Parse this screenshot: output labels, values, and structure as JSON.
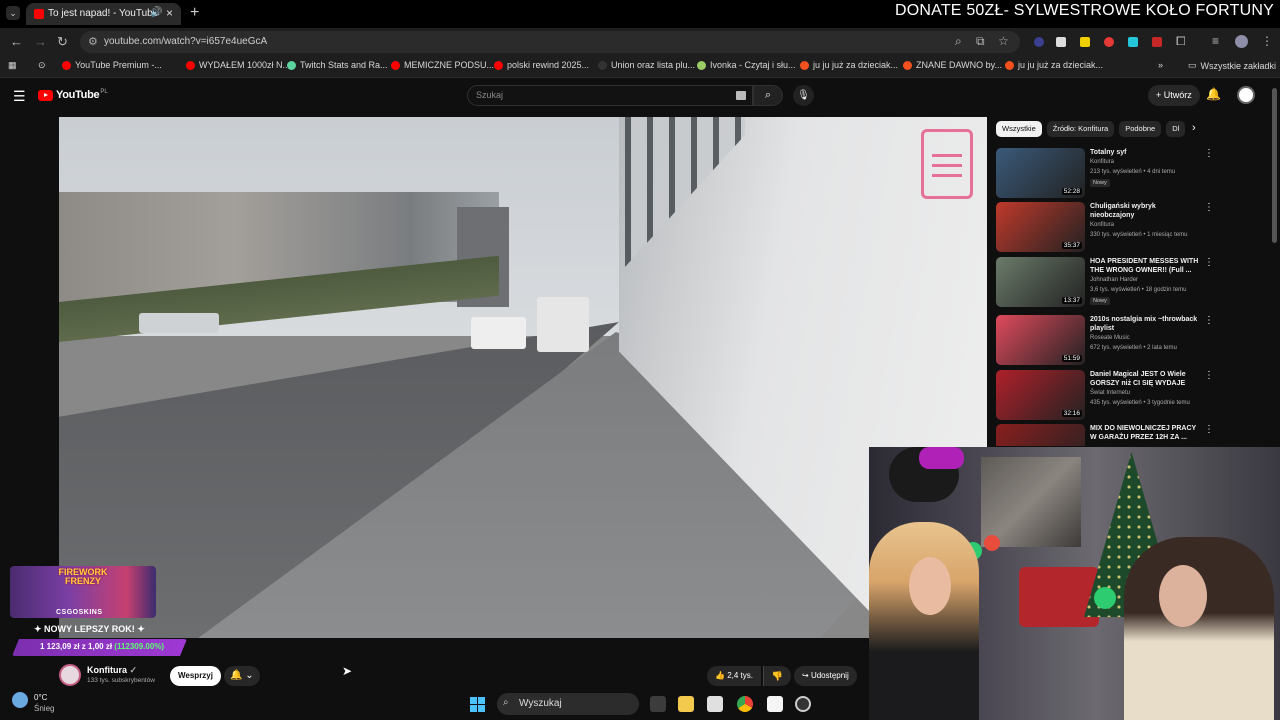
{
  "browser": {
    "tab_title": "To jest napad! - YouTube",
    "new_tab": "+",
    "url": "youtube.com/watch?v=i657e4ueGcA",
    "banner": "DONATE 50ZŁ- SYLWESTROWE KOŁO FORTUNY",
    "bookmarks": [
      {
        "label": "YouTube Premium -...",
        "color": "#ff0000"
      },
      {
        "label": "WYDAŁEM 1000zł N...",
        "color": "#ff0000"
      },
      {
        "label": "Twitch Stats and Ra...",
        "color": "#5dd39e"
      },
      {
        "label": "MEMICZNE PODSU...",
        "color": "#ff0000"
      },
      {
        "label": "polski rewind 2025...",
        "color": "#ff0000"
      },
      {
        "label": "Union oraz lista plu...",
        "color": "#333333"
      },
      {
        "label": "Ivonka - Czytaj i słu...",
        "color": "#9ccc65"
      },
      {
        "label": "ju ju już za dzieciak...",
        "color": "#f4511e"
      },
      {
        "label": "ZNANE DAWNO by...",
        "color": "#f4511e"
      },
      {
        "label": "ju ju już za dzieciak...",
        "color": "#f4511e"
      }
    ],
    "all_bookmarks": "Wszystkie zakładki"
  },
  "youtube": {
    "logo_text": "YouTube",
    "logo_region": "PL",
    "search_placeholder": "Szukaj",
    "create_label": "Utwórz",
    "channel": {
      "name": "Konfitura",
      "subs": "133 tys. subskrybentów"
    },
    "support_label": "Wesprzyj",
    "like_count": "2,4 tys.",
    "share_label": "Udostępnij",
    "chips": [
      "Wszystkie",
      "Źródło: Konfitura",
      "Podobne",
      "Dl"
    ],
    "recommendations": [
      {
        "title": "Totalny syf",
        "channel": "Konfitura",
        "stats": "213 tys. wyświetleń • 4 dni temu",
        "badge": "Nowy",
        "duration": "52:28",
        "thumb": "#3a5a7a"
      },
      {
        "title": "Chuligański wybryk nieobczajony",
        "channel": "Konfitura",
        "stats": "330 tys. wyświetleń • 1 miesiąc temu",
        "badge": "",
        "duration": "35:37",
        "thumb": "#c0392b"
      },
      {
        "title": "HOA PRESIDENT MESSES WITH THE WRONG OWNER!! (Full ...",
        "channel": "Johnathan Harder",
        "stats": "3,6 tys. wyświetleń • 18 godzin temu",
        "badge": "Nowy",
        "duration": "13:37",
        "thumb": "#6b7b6a"
      },
      {
        "title": "2010s nostalgia mix ~throwback playlist",
        "channel": "Roseate Music",
        "stats": "672 tys. wyświetleń • 2 lata temu",
        "badge": "",
        "duration": "51:59",
        "thumb": "#e04a5c"
      },
      {
        "title": "Daniel Magical JEST O Wiele GORSZY niż CI SIĘ WYDAJE",
        "channel": "Świat Internetu",
        "stats": "435 tys. wyświetleń • 3 tygodnie temu",
        "badge": "",
        "duration": "32:16",
        "thumb": "#b0202a"
      },
      {
        "title": "MIX DO NIEWOLNICZEJ PRACY W GARAŻU PRZEZ 12H ZA ...",
        "channel": "",
        "stats": "",
        "badge": "",
        "duration": "",
        "thumb": "#8a1e1e"
      }
    ]
  },
  "promo": {
    "title": "FIREWORK FRENZY",
    "brand": "CSGOSKINS",
    "slogan": "✦ NOWY LEPSZY ROK! ✦",
    "amount": "1 123,09 zł z 1,00 zł",
    "percent": "(112309.00%)"
  },
  "taskbar": {
    "temp": "0°C",
    "weather": "Śnieg",
    "search": "Wyszukaj"
  }
}
